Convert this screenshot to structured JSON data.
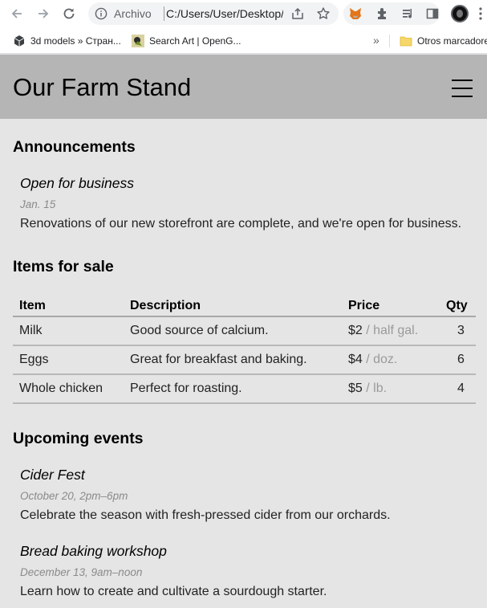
{
  "browser": {
    "address": {
      "scheme_label": "Archivo",
      "url": "C:/Users/User/Desktop/farm-stand/index.html"
    },
    "bookmarks": [
      {
        "label": "3d models » Стран..."
      },
      {
        "label": "Search Art | OpenG..."
      },
      {
        "label": "Otros marcadores"
      }
    ],
    "bookmarks_overflow": "»"
  },
  "site": {
    "title": "Our Farm Stand",
    "menu_label": "☰"
  },
  "announcements": {
    "heading": "Announcements",
    "items": [
      {
        "title": "Open for business",
        "date": "Jan. 15",
        "body": "Renovations of our new storefront are complete, and we're open for business."
      }
    ]
  },
  "items_for_sale": {
    "heading": "Items for sale",
    "columns": [
      "Item",
      "Description",
      "Price",
      "Qty"
    ],
    "rows": [
      {
        "item": "Milk",
        "description": "Good source of calcium.",
        "price": "$2",
        "unit": " / half gal.",
        "qty": "3"
      },
      {
        "item": "Eggs",
        "description": "Great for breakfast and baking.",
        "price": "$4",
        "unit": " / doz.",
        "qty": "6"
      },
      {
        "item": "Whole chicken",
        "description": "Perfect for roasting.",
        "price": "$5",
        "unit": " / lb.",
        "qty": "4"
      }
    ]
  },
  "upcoming_events": {
    "heading": "Upcoming events",
    "items": [
      {
        "title": "Cider Fest",
        "date": "October 20, 2pm–6pm",
        "body": "Celebrate the season with fresh-pressed cider from our orchards."
      },
      {
        "title": "Bread baking workshop",
        "date": "December 13, 9am–noon",
        "body": "Learn how to create and cultivate a sourdough starter."
      }
    ]
  }
}
